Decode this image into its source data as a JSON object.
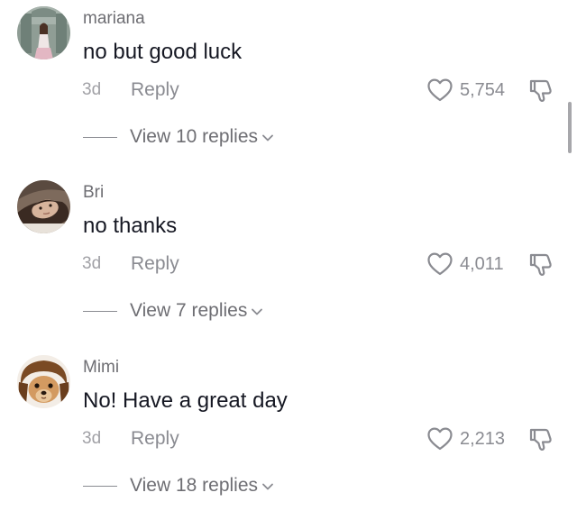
{
  "comments": [
    {
      "username": "mariana",
      "text": "no but good luck",
      "time": "3d",
      "reply_label": "Reply",
      "likes": "5,754",
      "view_replies": "View 10 replies",
      "avatar_icon": "avatar-photo"
    },
    {
      "username": "Bri",
      "text": "no thanks",
      "time": "3d",
      "reply_label": "Reply",
      "likes": "4,011",
      "view_replies": "View 7 replies",
      "avatar_icon": "avatar-photo"
    },
    {
      "username": "Mimi",
      "text": "No! Have a great day",
      "time": "3d",
      "reply_label": "Reply",
      "likes": "2,213",
      "view_replies": "View 18 replies",
      "avatar_icon": "avatar-dog-photo"
    }
  ],
  "icons": {
    "like": "heart-outline-icon",
    "dislike": "thumbs-down-icon",
    "expand": "chevron-down-icon"
  },
  "colors": {
    "text_primary": "#161823",
    "text_secondary": "#8a8b91"
  }
}
